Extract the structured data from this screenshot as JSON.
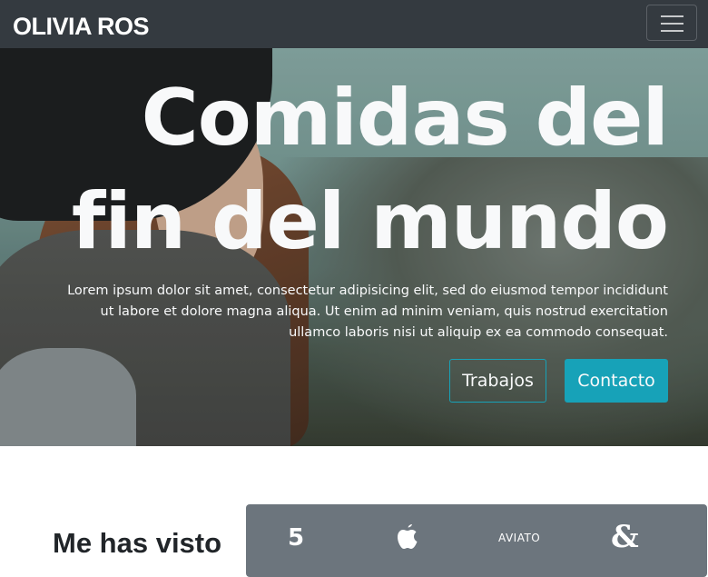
{
  "navbar": {
    "brand": "OLIVIA ROS",
    "toggle_icon": "hamburger-menu-icon"
  },
  "hero": {
    "title_line1": "Comidas del",
    "title_line2": "fin del mundo",
    "text": "Lorem ipsum dolor sit amet, consectetur adipisicing elit, sed do eiusmod tempor incididunt ut labore et dolore magna aliqua. Ut enim ad minim veniam, quis nostrud exercitation ullamco laboris nisi ut aliquip ex ea commodo consequat.",
    "buttons": {
      "trabajos": "Trabajos",
      "contacto": "Contacto"
    },
    "accent_color": "#17a2b8"
  },
  "section": {
    "title": "Me has visto"
  },
  "logos": {
    "items": [
      "five-logo",
      "apple-logo",
      "aviato-logo",
      "ampersand-logo"
    ],
    "aviato_text": "AVIATO",
    "five_text": "5",
    "amp_text": "&"
  }
}
